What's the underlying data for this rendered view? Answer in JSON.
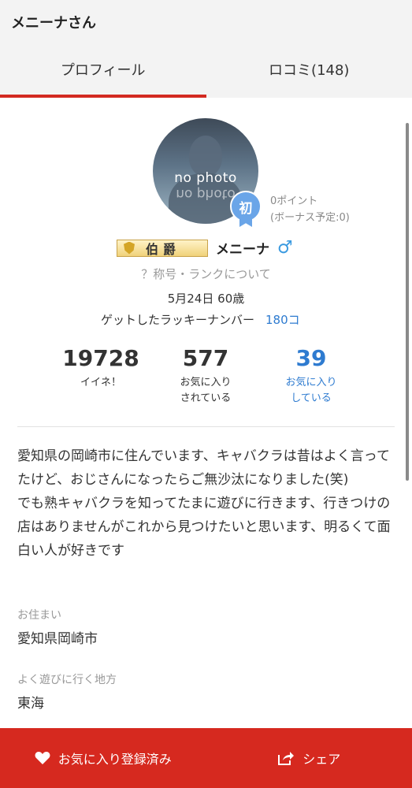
{
  "header": {
    "title": "メニーナさん"
  },
  "tabs": [
    {
      "label": "プロフィール"
    },
    {
      "label": "ロコミ(148)"
    }
  ],
  "profile": {
    "avatar_text": "no photo",
    "badge_text": "初",
    "points": "0ポイント",
    "bonus": "(ボーナス予定:0)",
    "rank_title": "伯爵",
    "username": "メニーナ",
    "gender_symbol": "♂",
    "rank_help": "？称号・ランクについて",
    "birthday": "5月24日 60歳",
    "lucky_label": "ゲットしたラッキーナンバー",
    "lucky_value": "180コ"
  },
  "stats": [
    {
      "value": "19728",
      "label": "イイネ！"
    },
    {
      "value": "577",
      "label": "お気に入り\nされている"
    },
    {
      "value": "39",
      "label": "お気に入り\nしている"
    }
  ],
  "bio": "愛知県の岡崎市に住んでいます、キャバクラは昔はよく言ってたけど、おじさんになったらご無沙汰になりました(笑)\nでも熟キャバクラを知ってたまに遊びに行きます、行きつけの店はありませんがこれから見つけたいと思います、明るくて面白い人が好きです",
  "fields": [
    {
      "label": "お住まい",
      "value": "愛知県岡崎市"
    },
    {
      "label": "よく遊びに行く地方",
      "value": "東海"
    }
  ],
  "bottom_bar": {
    "favorite_label": "お気に入り登録済み",
    "share_label": "シェア"
  },
  "colors": {
    "accent": "#d6291f",
    "link": "#2e7bd0",
    "gender": "#3a9ae0"
  }
}
